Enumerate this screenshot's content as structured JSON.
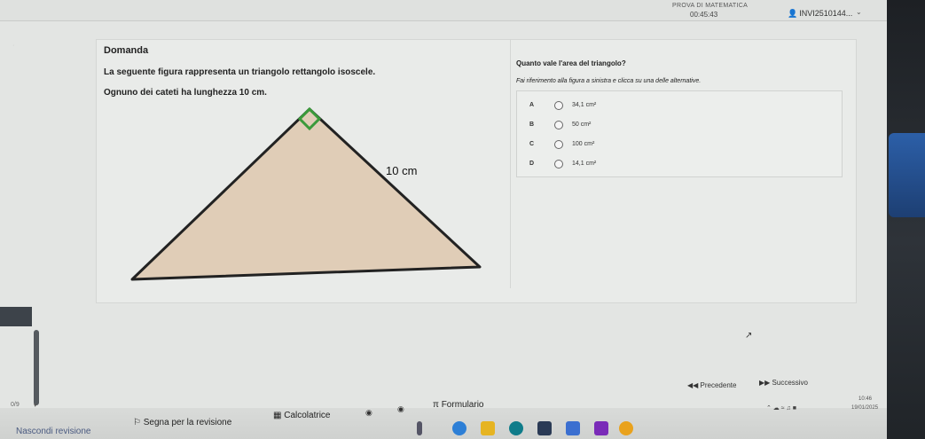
{
  "header": {
    "exam_title": "PROVA DI MATEMATICA",
    "timer": "00:45:43",
    "user": "INVI2510144..."
  },
  "question": {
    "heading": "Domanda",
    "line1": "La seguente figura rappresenta un triangolo rettangolo isoscele.",
    "line2": "Ognuno dei cateti ha lunghezza 10 cm.",
    "figure_label": "10 cm"
  },
  "answer": {
    "title": "Quanto vale l'area del triangolo?",
    "instruction": "Fai riferimento alla figura a sinistra e clicca su una delle alternative.",
    "options": [
      {
        "letter": "A",
        "value": "34,1 cm²"
      },
      {
        "letter": "B",
        "value": "50 cm²"
      },
      {
        "letter": "C",
        "value": "100 cm²"
      },
      {
        "letter": "D",
        "value": "14,1 cm²"
      }
    ]
  },
  "nav": {
    "prev": "Precedente",
    "next": "Successivo",
    "progress": "0/9"
  },
  "toolbar": {
    "hide_review": "Nascondi revisione",
    "flag_review": "Segna per la revisione",
    "calculator": "Calcolatrice",
    "formulas": "Formulario"
  },
  "tray": {
    "time": "10:46",
    "date": "19/01/2025"
  },
  "colors": {
    "triangle_fill": "#e0cdb7",
    "right_angle_marker": "#3a9a3a",
    "screen_bg": "#e3e5e3"
  }
}
